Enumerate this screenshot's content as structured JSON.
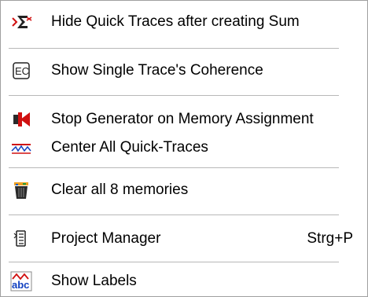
{
  "menu": {
    "items": [
      {
        "icon": "sum-icon",
        "label": "Hide Quick Traces after creating Sum"
      },
      {
        "icon": "coherence-icon",
        "label": "Show Single Trace's Coherence"
      },
      {
        "icon": "stop-generator-icon",
        "label": "Stop Generator on Memory Assignment"
      },
      {
        "icon": "center-traces-icon",
        "label": "Center All Quick-Traces"
      },
      {
        "icon": "clear-memories-icon",
        "label": "Clear all 8 memories"
      },
      {
        "icon": "project-manager-icon",
        "label": "Project Manager",
        "shortcut": "Strg+P"
      },
      {
        "icon": "labels-icon",
        "label": "Show Labels"
      }
    ]
  },
  "colors": {
    "separator": "#b8b8b8",
    "text": "#000000",
    "icon_red": "#d01010",
    "icon_orange": "#f0a020"
  }
}
